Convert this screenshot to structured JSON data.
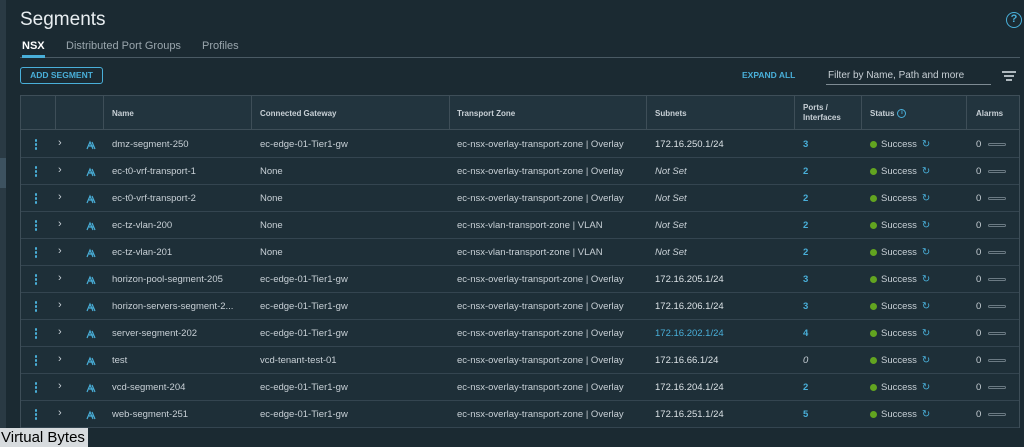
{
  "page": {
    "title": "Segments",
    "help_icon": "help-circle-icon"
  },
  "tabs": [
    {
      "label": "NSX",
      "active": true
    },
    {
      "label": "Distributed Port Groups",
      "active": false
    },
    {
      "label": "Profiles",
      "active": false
    }
  ],
  "toolbar": {
    "add_label": "ADD SEGMENT",
    "expand_label": "EXPAND ALL",
    "filter_placeholder": "Filter by Name, Path and more",
    "filter_icon": "filter-lines-icon"
  },
  "columns": {
    "name": "Name",
    "gateway": "Connected Gateway",
    "zone": "Transport Zone",
    "subnets": "Subnets",
    "ports_line1": "Ports /",
    "ports_line2": "Interfaces",
    "status": "Status",
    "alarms": "Alarms"
  },
  "colors": {
    "accent": "#49afd9",
    "success": "#62a420",
    "background": "#1b2a32"
  },
  "rows": [
    {
      "name": "dmz-segment-250",
      "gateway": "ec-edge-01-Tier1-gw",
      "zone": "ec-nsx-overlay-transport-zone | Overlay",
      "subnets": "172.16.250.1/24",
      "subnet_style": "value",
      "ports": "3",
      "status": "Success",
      "alarms": "0"
    },
    {
      "name": "ec-t0-vrf-transport-1",
      "gateway": "None",
      "zone": "ec-nsx-overlay-transport-zone | Overlay",
      "subnets": "Not Set",
      "subnet_style": "notset",
      "ports": "2",
      "status": "Success",
      "alarms": "0"
    },
    {
      "name": "ec-t0-vrf-transport-2",
      "gateway": "None",
      "zone": "ec-nsx-overlay-transport-zone | Overlay",
      "subnets": "Not Set",
      "subnet_style": "notset",
      "ports": "2",
      "status": "Success",
      "alarms": "0"
    },
    {
      "name": "ec-tz-vlan-200",
      "gateway": "None",
      "zone": "ec-nsx-vlan-transport-zone | VLAN",
      "subnets": "Not Set",
      "subnet_style": "notset",
      "ports": "2",
      "status": "Success",
      "alarms": "0"
    },
    {
      "name": "ec-tz-vlan-201",
      "gateway": "None",
      "zone": "ec-nsx-vlan-transport-zone | VLAN",
      "subnets": "Not Set",
      "subnet_style": "notset",
      "ports": "2",
      "status": "Success",
      "alarms": "0"
    },
    {
      "name": "horizon-pool-segment-205",
      "gateway": "ec-edge-01-Tier1-gw",
      "zone": "ec-nsx-overlay-transport-zone | Overlay",
      "subnets": "172.16.205.1/24",
      "subnet_style": "value",
      "ports": "3",
      "status": "Success",
      "alarms": "0"
    },
    {
      "name": "horizon-servers-segment-2...",
      "gateway": "ec-edge-01-Tier1-gw",
      "zone": "ec-nsx-overlay-transport-zone | Overlay",
      "subnets": "172.16.206.1/24",
      "subnet_style": "value",
      "ports": "3",
      "status": "Success",
      "alarms": "0"
    },
    {
      "name": "server-segment-202",
      "gateway": "ec-edge-01-Tier1-gw",
      "zone": "ec-nsx-overlay-transport-zone | Overlay",
      "subnets": "172.16.202.1/24",
      "subnet_style": "link",
      "ports": "4",
      "status": "Success",
      "alarms": "0"
    },
    {
      "name": "test",
      "gateway": "vcd-tenant-test-01",
      "zone": "ec-nsx-overlay-transport-zone | Overlay",
      "subnets": "172.16.66.1/24",
      "subnet_style": "value",
      "ports": "0",
      "status": "Success",
      "alarms": "0"
    },
    {
      "name": "vcd-segment-204",
      "gateway": "ec-edge-01-Tier1-gw",
      "zone": "ec-nsx-overlay-transport-zone | Overlay",
      "subnets": "172.16.204.1/24",
      "subnet_style": "value",
      "ports": "2",
      "status": "Success",
      "alarms": "0"
    },
    {
      "name": "web-segment-251",
      "gateway": "ec-edge-01-Tier1-gw",
      "zone": "ec-nsx-overlay-transport-zone | Overlay",
      "subnets": "172.16.251.1/24",
      "subnet_style": "value",
      "ports": "5",
      "status": "Success",
      "alarms": "0"
    }
  ],
  "watermark": "Virtual Bytes"
}
